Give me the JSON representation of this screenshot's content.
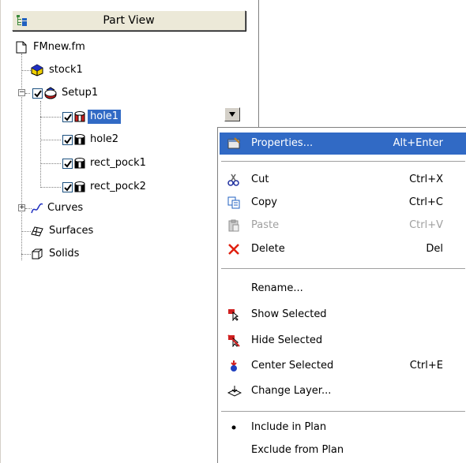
{
  "panel": {
    "title": "Part View"
  },
  "tree": {
    "root": "FMnew.fm",
    "stock": "stock1",
    "setup": "Setup1",
    "features": [
      "hole1",
      "hole2",
      "rect_pock1",
      "rect_pock2"
    ],
    "curves": "Curves",
    "surfaces": "Surfaces",
    "solids": "Solids"
  },
  "menu": {
    "items": [
      {
        "label": "Properties...",
        "shortcut": "Alt+Enter",
        "icon": "properties-icon"
      },
      {
        "label": "Cut",
        "shortcut": "Ctrl+X",
        "icon": "scissors-icon"
      },
      {
        "label": "Copy",
        "shortcut": "Ctrl+C",
        "icon": "copy-icon"
      },
      {
        "label": "Paste",
        "shortcut": "Ctrl+V",
        "icon": "paste-icon"
      },
      {
        "label": "Delete",
        "shortcut": "Del",
        "icon": "delete-icon"
      },
      {
        "label": "Rename...",
        "shortcut": "",
        "icon": ""
      },
      {
        "label": "Show Selected",
        "shortcut": "",
        "icon": "show-selected-icon"
      },
      {
        "label": "Hide Selected",
        "shortcut": "",
        "icon": "hide-selected-icon"
      },
      {
        "label": "Center Selected",
        "shortcut": "Ctrl+E",
        "icon": "center-selected-icon"
      },
      {
        "label": "Change Layer...",
        "shortcut": "",
        "icon": "change-layer-icon"
      },
      {
        "label": "Include in Plan",
        "shortcut": "",
        "icon": "bullet-icon"
      },
      {
        "label": "Exclude from Plan",
        "shortcut": "",
        "icon": ""
      }
    ]
  },
  "colors": {
    "selection": "#316ac5",
    "stock": "#f0d000",
    "feature": "#d02020"
  }
}
